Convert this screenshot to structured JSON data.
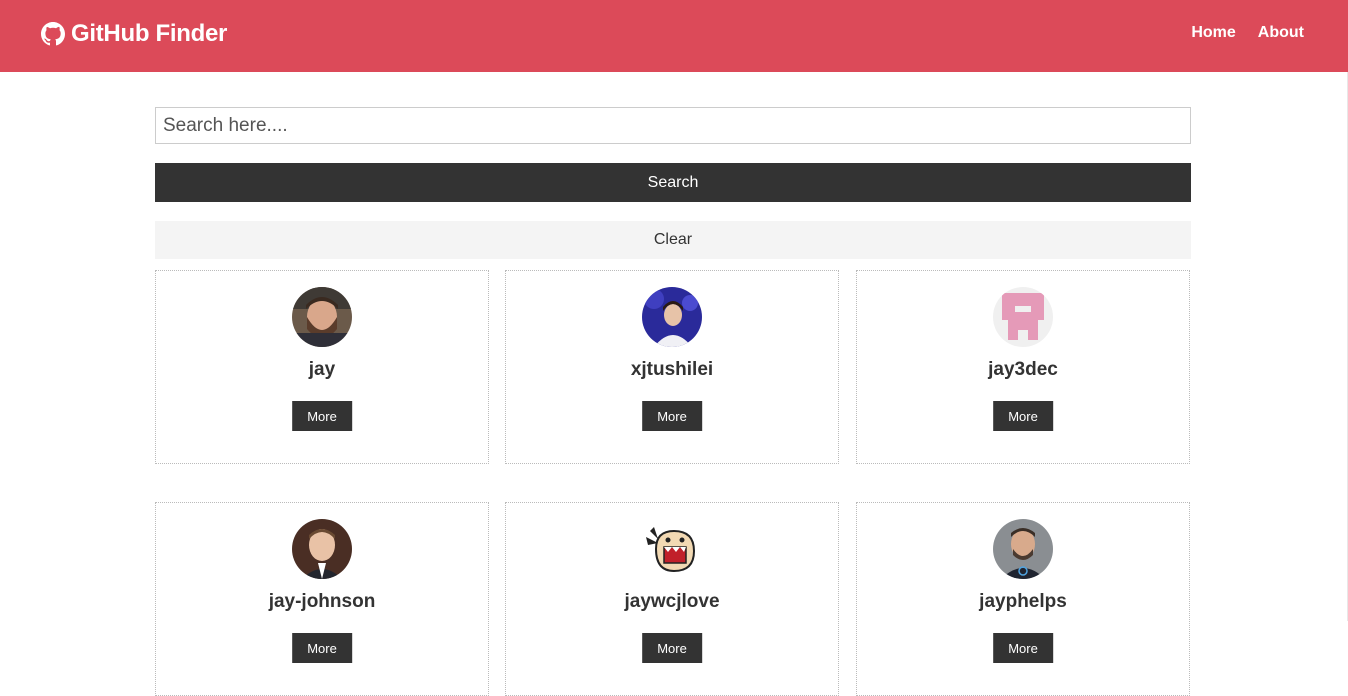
{
  "navbar": {
    "brand": "GitHub Finder",
    "brand_icon": "github-icon",
    "links": [
      {
        "label": "Home"
      },
      {
        "label": "About"
      }
    ],
    "color": "#dc4a59"
  },
  "search": {
    "placeholder": "Search here....",
    "value": "",
    "submit_label": "Search",
    "clear_label": "Clear"
  },
  "users": [
    {
      "login": "jay",
      "more_label": "More",
      "avatar": "avatar-photo"
    },
    {
      "login": "xjtushilei",
      "more_label": "More",
      "avatar": "avatar-photo"
    },
    {
      "login": "jay3dec",
      "more_label": "More",
      "avatar": "identicon-avatar"
    },
    {
      "login": "jay-johnson",
      "more_label": "More",
      "avatar": "avatar-photo"
    },
    {
      "login": "jaywcjlove",
      "more_label": "More",
      "avatar": "cartoon-avatar"
    },
    {
      "login": "jayphelps",
      "more_label": "More",
      "avatar": "avatar-photo"
    }
  ]
}
